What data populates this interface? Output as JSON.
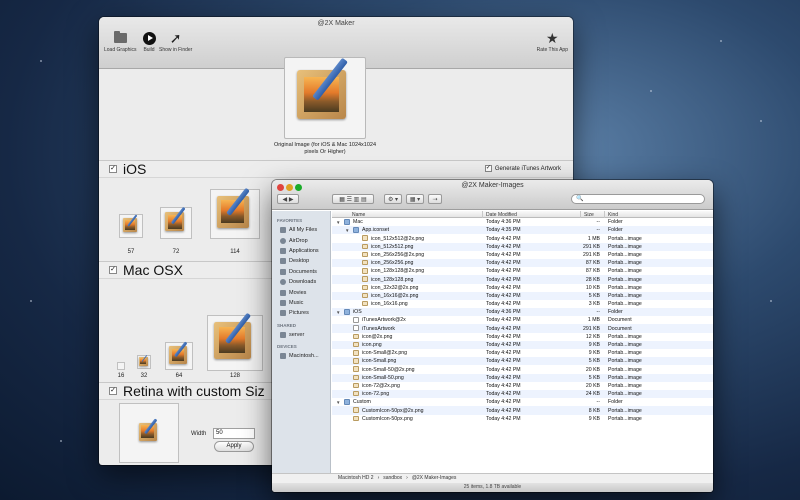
{
  "app": {
    "title": "@2X Maker",
    "toolbar": {
      "load_graphics": "Load Graphics",
      "build": "Build",
      "show_in_finder": "Show in Finder",
      "rate_this_app": "Rate This App"
    },
    "original_caption": "Original Image (for iOS & Mac 1024x1024 pixels Or Higher)",
    "sections": {
      "ios": "iOS",
      "mac": "Mac OSX",
      "retina": "Retina with custom Siz"
    },
    "generate_itunes": "Generate iTunes Artwork",
    "ios_sizes": [
      "57",
      "72",
      "114"
    ],
    "mac_sizes": [
      "16",
      "32",
      "64",
      "128"
    ],
    "width_label": "Width",
    "width_value": "50",
    "apply_label": "Apply"
  },
  "finder": {
    "title": "@2X Maker-Images",
    "search_placeholder": "",
    "columns": {
      "name": "Name",
      "date": "Date Modified",
      "size": "Size",
      "kind": "Kind"
    },
    "sidebar": {
      "favorites_head": "FAVORITES",
      "favorites": [
        "All My Files",
        "AirDrop",
        "Applications",
        "Desktop",
        "Documents",
        "Downloads",
        "Movies",
        "Music",
        "Pictures"
      ],
      "shared_head": "SHARED",
      "shared": [
        "server"
      ],
      "devices_head": "DEVICES",
      "devices": [
        "Macintosh..."
      ]
    },
    "rows": [
      {
        "indent": 0,
        "type": "folder",
        "open": true,
        "name": "Mac",
        "date": "Today 4:36 PM",
        "size": "--",
        "kind": "Folder"
      },
      {
        "indent": 1,
        "type": "folder",
        "open": true,
        "name": "App.iconset",
        "date": "Today 4:35 PM",
        "size": "--",
        "kind": "Folder"
      },
      {
        "indent": 2,
        "type": "png",
        "name": "icon_512x512@2x.png",
        "date": "Today 4:42 PM",
        "size": "1 MB",
        "kind": "Portab...image"
      },
      {
        "indent": 2,
        "type": "png",
        "name": "icon_512x512.png",
        "date": "Today 4:42 PM",
        "size": "291 KB",
        "kind": "Portab...image"
      },
      {
        "indent": 2,
        "type": "png",
        "name": "icon_256x256@2x.png",
        "date": "Today 4:42 PM",
        "size": "291 KB",
        "kind": "Portab...image"
      },
      {
        "indent": 2,
        "type": "png",
        "name": "icon_256x256.png",
        "date": "Today 4:42 PM",
        "size": "87 KB",
        "kind": "Portab...image"
      },
      {
        "indent": 2,
        "type": "png",
        "name": "icon_128x128@2x.png",
        "date": "Today 4:42 PM",
        "size": "87 KB",
        "kind": "Portab...image"
      },
      {
        "indent": 2,
        "type": "png",
        "name": "icon_128x128.png",
        "date": "Today 4:42 PM",
        "size": "28 KB",
        "kind": "Portab...image"
      },
      {
        "indent": 2,
        "type": "png",
        "name": "icon_32x32@2x.png",
        "date": "Today 4:42 PM",
        "size": "10 KB",
        "kind": "Portab...image"
      },
      {
        "indent": 2,
        "type": "png",
        "name": "icon_16x16@2x.png",
        "date": "Today 4:42 PM",
        "size": "5 KB",
        "kind": "Portab...image"
      },
      {
        "indent": 2,
        "type": "png",
        "name": "icon_16x16.png",
        "date": "Today 4:42 PM",
        "size": "3 KB",
        "kind": "Portab...image"
      },
      {
        "indent": 0,
        "type": "folder",
        "open": true,
        "name": "iOS",
        "date": "Today 4:36 PM",
        "size": "--",
        "kind": "Folder"
      },
      {
        "indent": 1,
        "type": "doc",
        "name": "iTunesArtwork@2x",
        "date": "Today 4:42 PM",
        "size": "1 MB",
        "kind": "Document"
      },
      {
        "indent": 1,
        "type": "doc",
        "name": "iTunesArtwork",
        "date": "Today 4:42 PM",
        "size": "291 KB",
        "kind": "Document"
      },
      {
        "indent": 1,
        "type": "png",
        "name": "icon@2x.png",
        "date": "Today 4:42 PM",
        "size": "12 KB",
        "kind": "Portab...image"
      },
      {
        "indent": 1,
        "type": "png",
        "name": "icon.png",
        "date": "Today 4:42 PM",
        "size": "9 KB",
        "kind": "Portab...image"
      },
      {
        "indent": 1,
        "type": "png",
        "name": "icon-Small@2x.png",
        "date": "Today 4:42 PM",
        "size": "9 KB",
        "kind": "Portab...image"
      },
      {
        "indent": 1,
        "type": "png",
        "name": "icon-Small.png",
        "date": "Today 4:42 PM",
        "size": "5 KB",
        "kind": "Portab...image"
      },
      {
        "indent": 1,
        "type": "png",
        "name": "icon-Small-50@2x.png",
        "date": "Today 4:42 PM",
        "size": "20 KB",
        "kind": "Portab...image"
      },
      {
        "indent": 1,
        "type": "png",
        "name": "icon-Small-50.png",
        "date": "Today 4:42 PM",
        "size": "5 KB",
        "kind": "Portab...image"
      },
      {
        "indent": 1,
        "type": "png",
        "name": "icon-72@2x.png",
        "date": "Today 4:42 PM",
        "size": "20 KB",
        "kind": "Portab...image"
      },
      {
        "indent": 1,
        "type": "png",
        "name": "icon-72.png",
        "date": "Today 4:42 PM",
        "size": "24 KB",
        "kind": "Portab...image"
      },
      {
        "indent": 0,
        "type": "folder",
        "open": true,
        "name": "Custom",
        "date": "Today 4:42 PM",
        "size": "--",
        "kind": "Folder"
      },
      {
        "indent": 1,
        "type": "png",
        "name": "CustomIcon-50px@2x.png",
        "date": "Today 4:42 PM",
        "size": "8 KB",
        "kind": "Portab...image"
      },
      {
        "indent": 1,
        "type": "png",
        "name": "CustomIcon-50px.png",
        "date": "Today 4:42 PM",
        "size": "9 KB",
        "kind": "Portab...image"
      }
    ],
    "path": [
      "Macintosh HD 2",
      "sandbox",
      "@2X Maker-Images"
    ],
    "status": "25 items, 1.8 TB available"
  }
}
